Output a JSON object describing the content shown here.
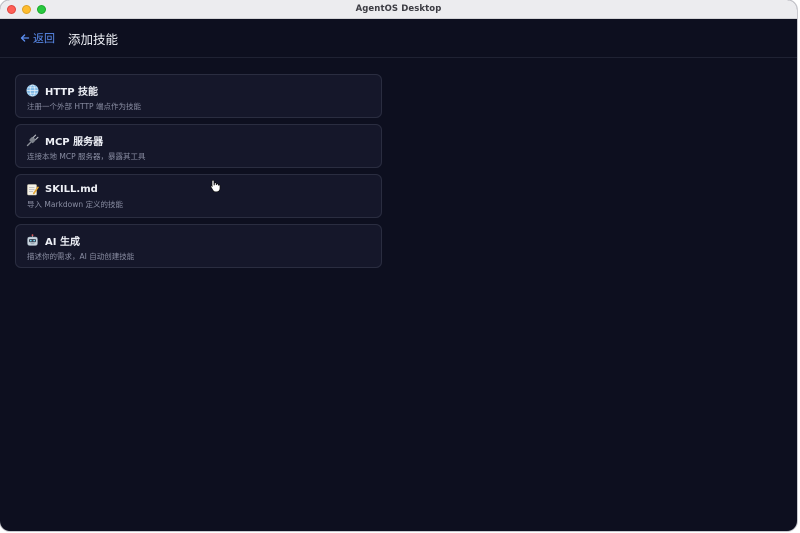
{
  "window": {
    "title": "AgentOS Desktop"
  },
  "header": {
    "back_label": "返回",
    "page_title": "添加技能"
  },
  "skills": [
    {
      "icon": "globe-icon",
      "title": "HTTP 技能",
      "description": "注册一个外部 HTTP 端点作为技能"
    },
    {
      "icon": "plug-icon",
      "title": "MCP 服务器",
      "description": "连接本地 MCP 服务器，暴露其工具"
    },
    {
      "icon": "memo-icon",
      "title": "SKILL.md",
      "description": "导入 Markdown 定义的技能"
    },
    {
      "icon": "robot-icon",
      "title": "AI 生成",
      "description": "描述你的需求，AI 自动创建技能"
    }
  ],
  "colors": {
    "background": "#0d0f1f",
    "card": "#15172a",
    "accent": "#5b8def"
  }
}
